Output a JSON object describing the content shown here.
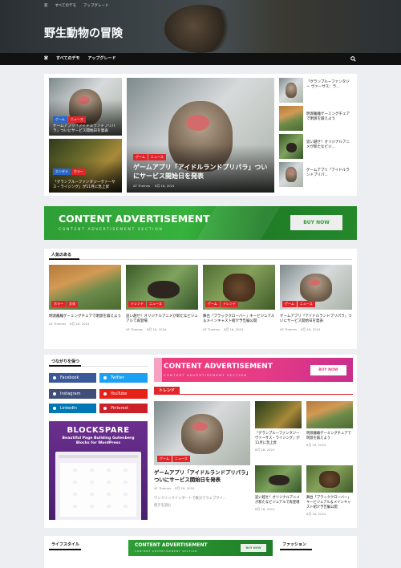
{
  "topbar": {
    "links": [
      "家",
      "すべてのデモ",
      "アップグレード"
    ]
  },
  "header": {
    "site_title": "野生動物の冒険"
  },
  "nav": {
    "items": [
      "家",
      "すべてのデモ",
      "アップグレード"
    ]
  },
  "hero": {
    "left": [
      {
        "tags": [
          "ゲーム",
          "ニュース"
        ],
        "title": "ゲームアプリ「アイドルランドプリパラ」ついにサービス開始日を発表"
      },
      {
        "tags": [
          "エンタメ",
          "ホラー"
        ],
        "title": "「グランブルーファンタジーヴァーサス・ライジング」が11月に急上昇"
      }
    ],
    "main": {
      "tags": [
        "ゲーム",
        "ニュース"
      ],
      "title": "ゲームアプリ「アイドルランドプリパラ」ついにサービス開始日を発表",
      "author": "AF Themes",
      "date": "8月 16, 2024"
    },
    "right": [
      "「グランブルーファンタジー ヴァーサス：ラ...",
      "明渡離離ゲーミングチェアで明渡を鍛えよう",
      "追い越せ！オリジナルアニメが新たなビジ...",
      "ゲームアプリ「アイドルランドプリパ..."
    ]
  },
  "ad1": {
    "title": "CONTENT ADVERTISEMENT",
    "sub": "CONTENT ADVERTISEMENT SECTION",
    "button": "BUY NOW"
  },
  "popular": {
    "heading": "人気のある",
    "items": [
      {
        "tags": [
          "ホラー",
          "文化"
        ],
        "title": "明渡離離ゲーミングチェアで明渡を鍛えよう",
        "author": "AF Themes",
        "date": "8月 16, 2024"
      },
      {
        "tags": [
          "トレンド",
          "ニュース"
        ],
        "title": "追い越せ！オリジナルアニメが新たなビジュアルで再登場",
        "author": "AF Themes",
        "date": "8月 16, 2024"
      },
      {
        "tags": [
          "ゲーム",
          "トレンド"
        ],
        "title": "舞台「ブラッククローバー」キービジュアル＆メインキャスト紹介予告編公開",
        "author": "AF Themes",
        "date": "8月 16, 2024"
      },
      {
        "tags": [
          "ゲーム",
          "ニュース"
        ],
        "title": "ゲームアプリ「アイドルランドプリパラ」ついにサービス開始日を発表",
        "author": "AF Themes",
        "date": "8月 16, 2024"
      }
    ]
  },
  "social": {
    "heading": "つながりを保つ",
    "buttons": [
      {
        "label": "Facebook",
        "color": "#3b5998"
      },
      {
        "label": "Twitter",
        "color": "#1da1f2"
      },
      {
        "label": "Instagram",
        "color": "#3f4f7a"
      },
      {
        "label": "YouTube",
        "color": "#e62117"
      },
      {
        "label": "LinkedIn",
        "color": "#0077b5"
      },
      {
        "label": "Pinterest",
        "color": "#cb2027"
      }
    ]
  },
  "blockspare": {
    "title": "BLOCKSPARE",
    "sub": "Beautiful Page Building Gutenberg Blocks for WordPress"
  },
  "ad2": {
    "title": "CONTENT ADVERTISEMENT",
    "sub": "CONTENT ADVERTISEMENT SECTION",
    "button": "BUY NOW"
  },
  "trend": {
    "heading": "トレンド",
    "main": {
      "tags": [
        "ゲーム",
        "ニュース"
      ],
      "title": "ゲームアプリ「アイドルランドプリパラ」ついにサービス開始日を発表",
      "author": "AF Themes",
      "date": "8月 16, 2024",
      "excerpt": "ワンクリックインポートで数分でウェブサイ...",
      "more": "続きを読む"
    },
    "grid": [
      {
        "title": "「グランブルーファンタジー ヴァーサス・ライジング」が11月に急上昇",
        "date": "8月 16, 2024"
      },
      {
        "title": "明渡離離ゲーミングチェアで明渡を鍛えよう",
        "date": "8月 16, 2024"
      },
      {
        "title": "追い越せ！オリジナルアニメが新たなビジュアルで再登場",
        "date": "8月 16, 2024"
      },
      {
        "title": "舞台「ブラッククローバー」キービジュアル＆メインキャスト紹介予告編公開",
        "date": "8月 16, 2024"
      }
    ]
  },
  "bottom": {
    "left": "ライフスタイル",
    "ad": "CONTENT ADVERTISEMENT",
    "ad_sub": "CONTENT ADVERTISEMENT SECTION",
    "ad_btn": "BUY NOW",
    "right": "ファッション"
  },
  "colors": {
    "accent": "#e0262b",
    "nav_bg": "#111111",
    "ad_green": "#2e9e35",
    "ad_pink": "#e63b86"
  }
}
